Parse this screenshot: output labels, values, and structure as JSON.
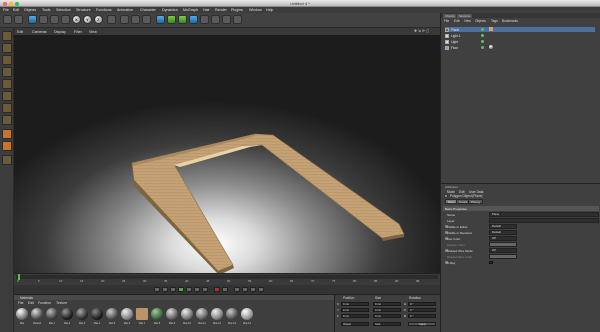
{
  "window": {
    "title": "Untitled 4 *"
  },
  "menubar": [
    "File",
    "Edit",
    "Objects",
    "Tools",
    "Selection",
    "Structure",
    "Functions",
    "Animation",
    "Character",
    "Dynamics",
    "MoGraph",
    "Hair",
    "Render",
    "Plugins",
    "Window",
    "Help"
  ],
  "toolbar": {
    "axis_buttons": [
      "X",
      "Y",
      "Z"
    ]
  },
  "viewport": {
    "menu": [
      "Edit",
      "Cameras",
      "Display",
      "Filter",
      "View"
    ]
  },
  "timeline": {
    "ticks": [
      "0",
      "5",
      "10",
      "15",
      "20",
      "25",
      "30",
      "35",
      "40",
      "45",
      "50",
      "55",
      "60",
      "65",
      "70",
      "75",
      "80",
      "85",
      "90",
      "95"
    ]
  },
  "materials": {
    "header": "Materials",
    "menu": [
      "File",
      "Edit",
      "Function",
      "Texture"
    ],
    "items": [
      "Mat",
      "Default",
      "Mat.1",
      "Mat.2",
      "Mat.3",
      "Mat.4",
      "Mat.5",
      "Mat.6",
      "Mat.7",
      "Mat.8",
      "Mat.9",
      "Mat.10",
      "Mat.11",
      "Mat.12",
      "Mat.13",
      "Mat.14"
    ]
  },
  "coordinates": {
    "headers": [
      "Position",
      "Size",
      "Rotation"
    ],
    "rows": [
      {
        "axis": "X",
        "position": "0 cm",
        "size": "0 cm",
        "rot_label": "H",
        "rotation": "0 °"
      },
      {
        "axis": "Y",
        "position": "0 cm",
        "size": "0 cm",
        "rot_label": "P",
        "rotation": "0 °"
      },
      {
        "axis": "Z",
        "position": "0 cm",
        "size": "0 cm",
        "rot_label": "B",
        "rotation": "0 °"
      }
    ],
    "mode": "Object",
    "space": "Size",
    "apply": "Apply"
  },
  "object_manager": {
    "tabs": [
      "Objects",
      "Structure"
    ],
    "menu": [
      "File",
      "Edit",
      "View",
      "Objects",
      "Tags",
      "Bookmarks"
    ],
    "objects": [
      "Plane",
      "Light.1",
      "Light",
      "Floor"
    ]
  },
  "attributes": {
    "header": "Attributes",
    "menu": [
      "Mode",
      "Edit",
      "User Data"
    ],
    "object_title": "Polygon Object [Plane]",
    "tabs": [
      "Basic",
      "Coord.",
      "Phong"
    ],
    "section": "Basic Properties",
    "rows": [
      {
        "label": "Name",
        "value": "Plane"
      },
      {
        "label": "Layer",
        "value": ""
      },
      {
        "label": "Visible in Editor",
        "value": "Default"
      },
      {
        "label": "Visible in Renderer",
        "value": "Default"
      },
      {
        "label": "Use Color",
        "value": "Off"
      },
      {
        "label": "Display Color",
        "value": ""
      },
      {
        "label": "Shaded Wire Mode",
        "value": "Off"
      },
      {
        "label": "Shaded Wire Color",
        "value": ""
      },
      {
        "label": "X-Ray",
        "value": ""
      }
    ]
  },
  "colors": {
    "accent": "#3d7fc4",
    "wood": "#c8a67a",
    "background": "#4a4a4a"
  }
}
